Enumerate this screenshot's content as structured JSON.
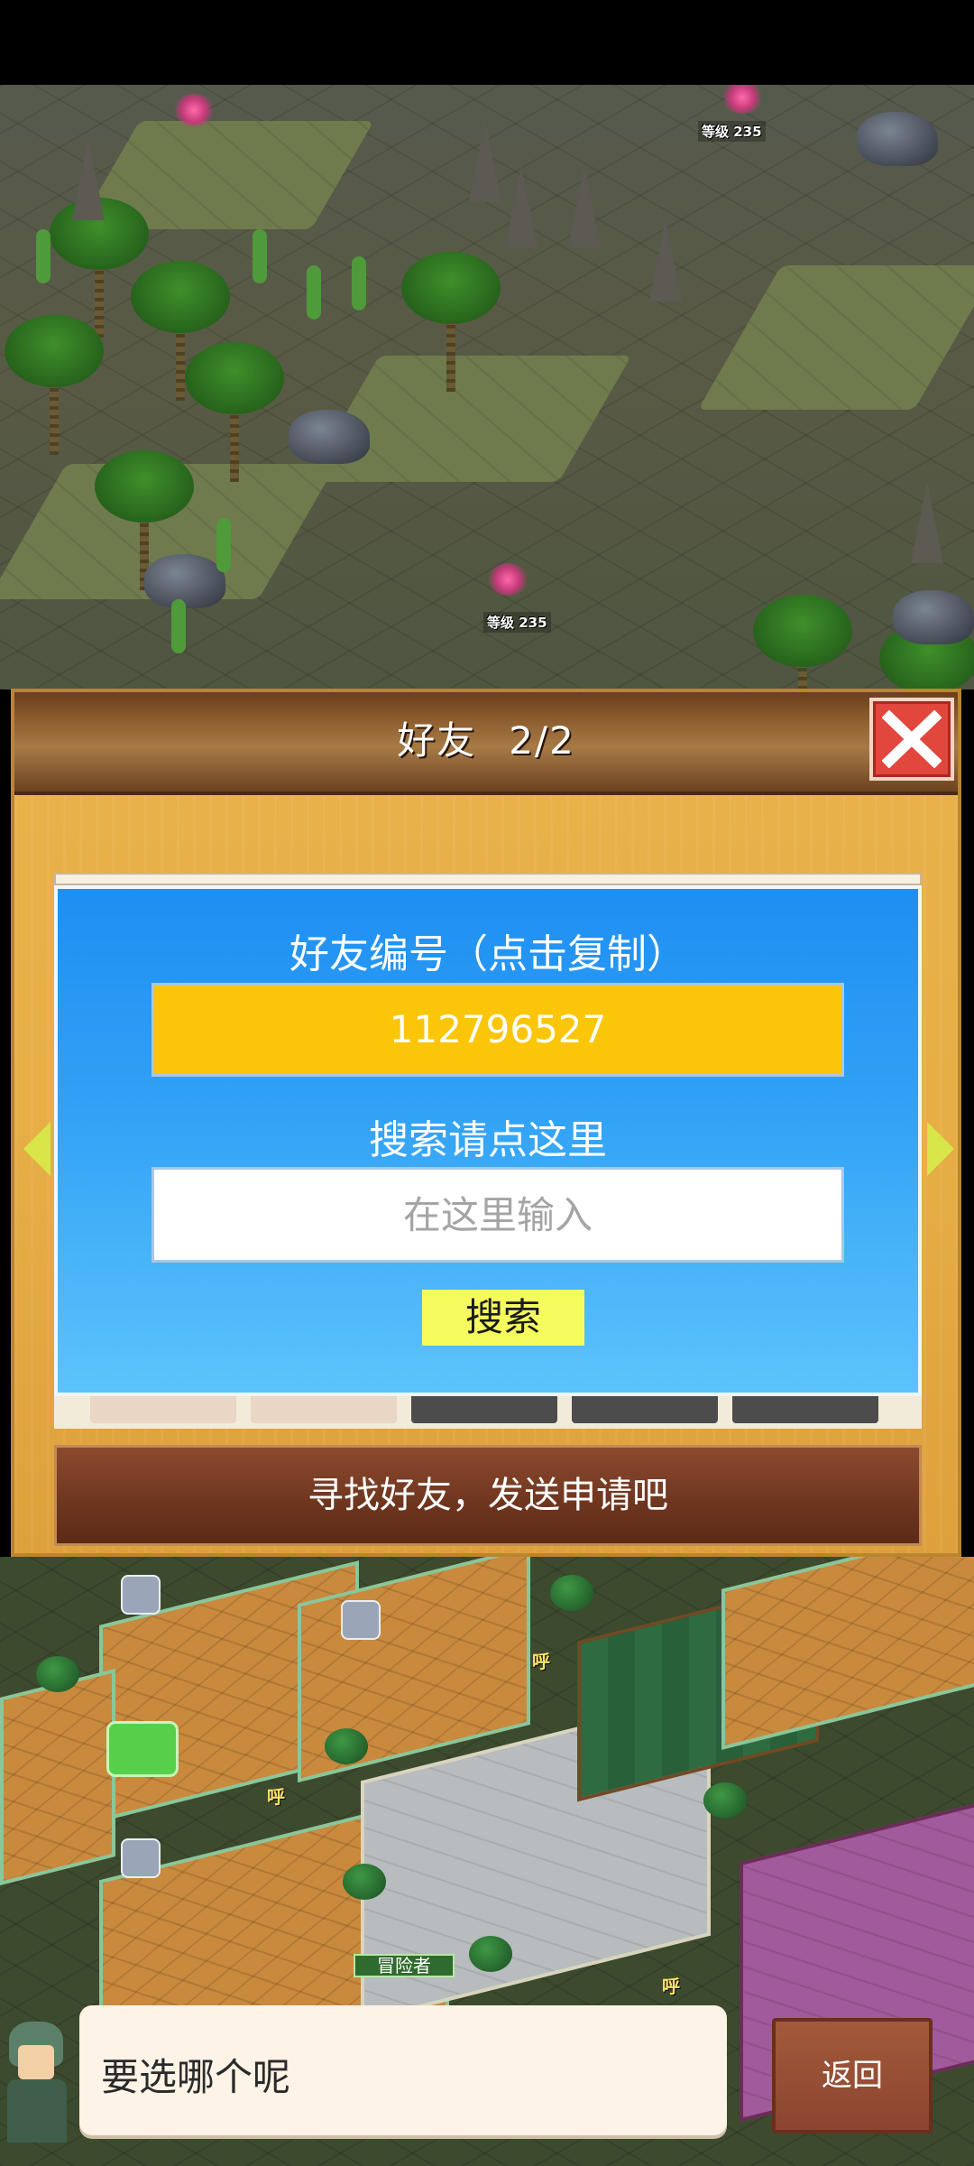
{
  "map": {
    "level_label_1": "等级 235",
    "level_label_2": "等级 235",
    "huh_label": "呼",
    "adventurer_tag": "冒险者"
  },
  "dialog": {
    "title": "好友",
    "count": "2/2",
    "close_icon": "close-x-icon",
    "id_label": "好友编号（点击复制）",
    "friend_id": "112796527",
    "search_label": "搜索请点这里",
    "search_placeholder": "在这里输入",
    "search_button": "搜索",
    "find_button": "寻找好友，发送申请吧"
  },
  "bottom": {
    "speech_text": "要选哪个呢",
    "back_button": "返回"
  },
  "colors": {
    "panel_blue": "#1e8ff2",
    "id_yellow": "#fbc508",
    "search_button_yellow": "#f5fb5d",
    "close_red": "#e1473c",
    "dialog_gold": "#e9b24a"
  }
}
